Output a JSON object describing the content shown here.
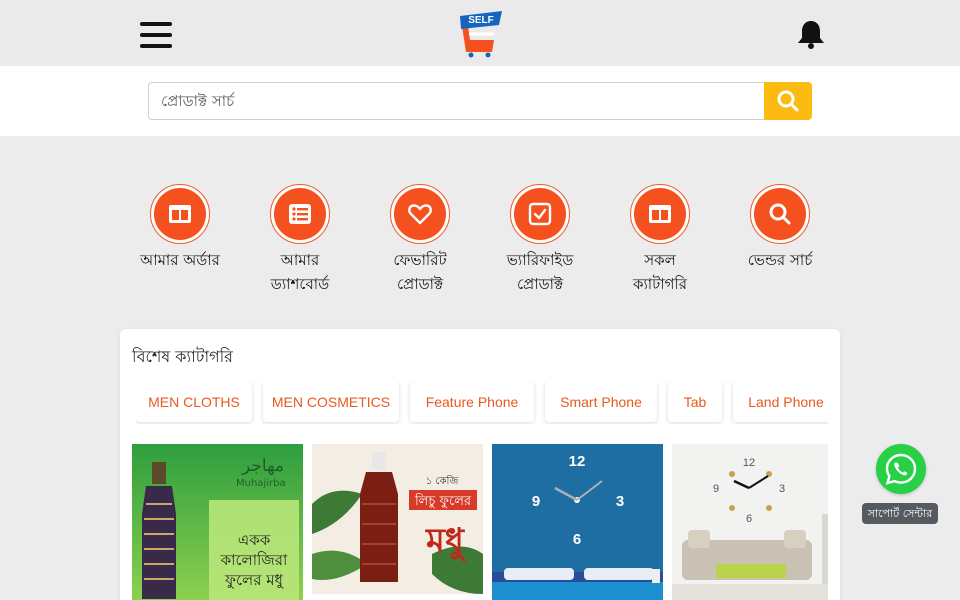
{
  "header": {
    "menu_icon": "hamburger-menu-icon",
    "logo_text": "SELF",
    "notification_icon": "bell-icon"
  },
  "search": {
    "placeholder": "প্রোডাক্ট সার্চ",
    "button_icon": "search-icon"
  },
  "quick_links": [
    {
      "label": "আমার অর্ডার",
      "icon": "columns-icon"
    },
    {
      "label": "আমার\nড্যাশবোর্ড",
      "icon": "list-icon"
    },
    {
      "label": "ফেভারিট\nপ্রোডাক্ট",
      "icon": "heart-icon"
    },
    {
      "label": "ভ্যারিফাইড\nপ্রোডাক্ট",
      "icon": "check-square-icon"
    },
    {
      "label": "সকল\nক্যাটাগরি",
      "icon": "columns-icon"
    },
    {
      "label": "ভেন্ডর সার্চ",
      "icon": "search-icon"
    }
  ],
  "special_categories": {
    "title": "বিশেষ ক্যাটাগরি",
    "chips": [
      "MEN CLOTHS",
      "MEN COSMETICS",
      "Feature Phone",
      "Smart Phone",
      "Tab",
      "Land Phone"
    ]
  },
  "products": [
    {
      "name": "kalojira-honey",
      "brand_logo": "Muhajirba",
      "text": "একক\nকালোজিরা\nফুলের মধু"
    },
    {
      "name": "litchi-honey",
      "text_top": "লিচু ফুলের",
      "text_main": "মধু"
    },
    {
      "name": "blue-wall-clock",
      "clock_numbers": [
        "12",
        "3",
        "6",
        "9"
      ]
    },
    {
      "name": "living-room-wall-clock",
      "clock_numbers": [
        "12",
        "3",
        "6",
        "9"
      ]
    }
  ],
  "support": {
    "label": "সাপোর্ট সেন্টার",
    "icon": "whatsapp-icon"
  },
  "colors": {
    "accent": "#f4511e",
    "search_button": "#fbbb10",
    "chip_text": "#e85a1e",
    "whatsapp": "#27d045"
  }
}
